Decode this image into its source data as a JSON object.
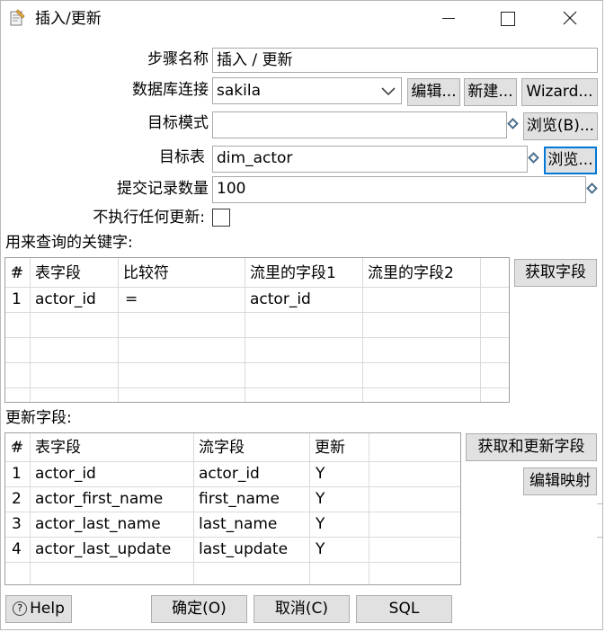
{
  "window": {
    "title": "插入/更新",
    "app_icon": "document-pencil-icon",
    "controls": {
      "minimize": "—",
      "maximize": "☐",
      "close": "✕"
    }
  },
  "form": {
    "step_name_label": "步骤名称",
    "step_name_value": "插入 / 更新",
    "db_connection_label": "数据库连接",
    "db_connection_value": "sakila",
    "edit_button": "编辑...",
    "new_button": "新建...",
    "wizard_button": "Wizard...",
    "target_schema_label": "目标模式",
    "target_schema_value": "",
    "browse_schema_button": "浏览(B)...",
    "target_table_label": "目标表",
    "target_table_value": "dim_actor",
    "browse_table_button": "浏览...",
    "commit_size_label": "提交记录数量",
    "commit_size_value": "100",
    "no_update_label": "不执行任何更新:"
  },
  "keys_section": {
    "title": "用来查询的关键字:",
    "get_fields_button": "获取字段",
    "columns": [
      "#",
      "表字段",
      "比较符",
      "流里的字段1",
      "流里的字段2"
    ],
    "rows": [
      {
        "num": "1",
        "table_field": "actor_id",
        "comparator": "=",
        "stream_field1": "actor_id",
        "stream_field2": ""
      }
    ]
  },
  "update_section": {
    "title": "更新字段:",
    "get_update_fields_button": "获取和更新字段",
    "edit_mapping_button": "编辑映射",
    "columns": [
      "#",
      "表字段",
      "流字段",
      "更新"
    ],
    "rows": [
      {
        "num": "1",
        "table_field": "actor_id",
        "stream_field": "actor_id",
        "update": "Y"
      },
      {
        "num": "2",
        "table_field": "actor_first_name",
        "stream_field": "first_name",
        "update": "Y"
      },
      {
        "num": "3",
        "table_field": "actor_last_name",
        "stream_field": "last_name",
        "update": "Y"
      },
      {
        "num": "4",
        "table_field": "actor_last_update",
        "stream_field": "last_update",
        "update": "Y"
      }
    ]
  },
  "footer": {
    "help_button": "Help",
    "ok_button": "确定(O)",
    "cancel_button": "取消(C)",
    "sql_button": "SQL"
  },
  "colors": {
    "focus_border": "#0078d7",
    "button_bg": "#e1e1e1",
    "variable_icon": "#4d6f8c"
  }
}
